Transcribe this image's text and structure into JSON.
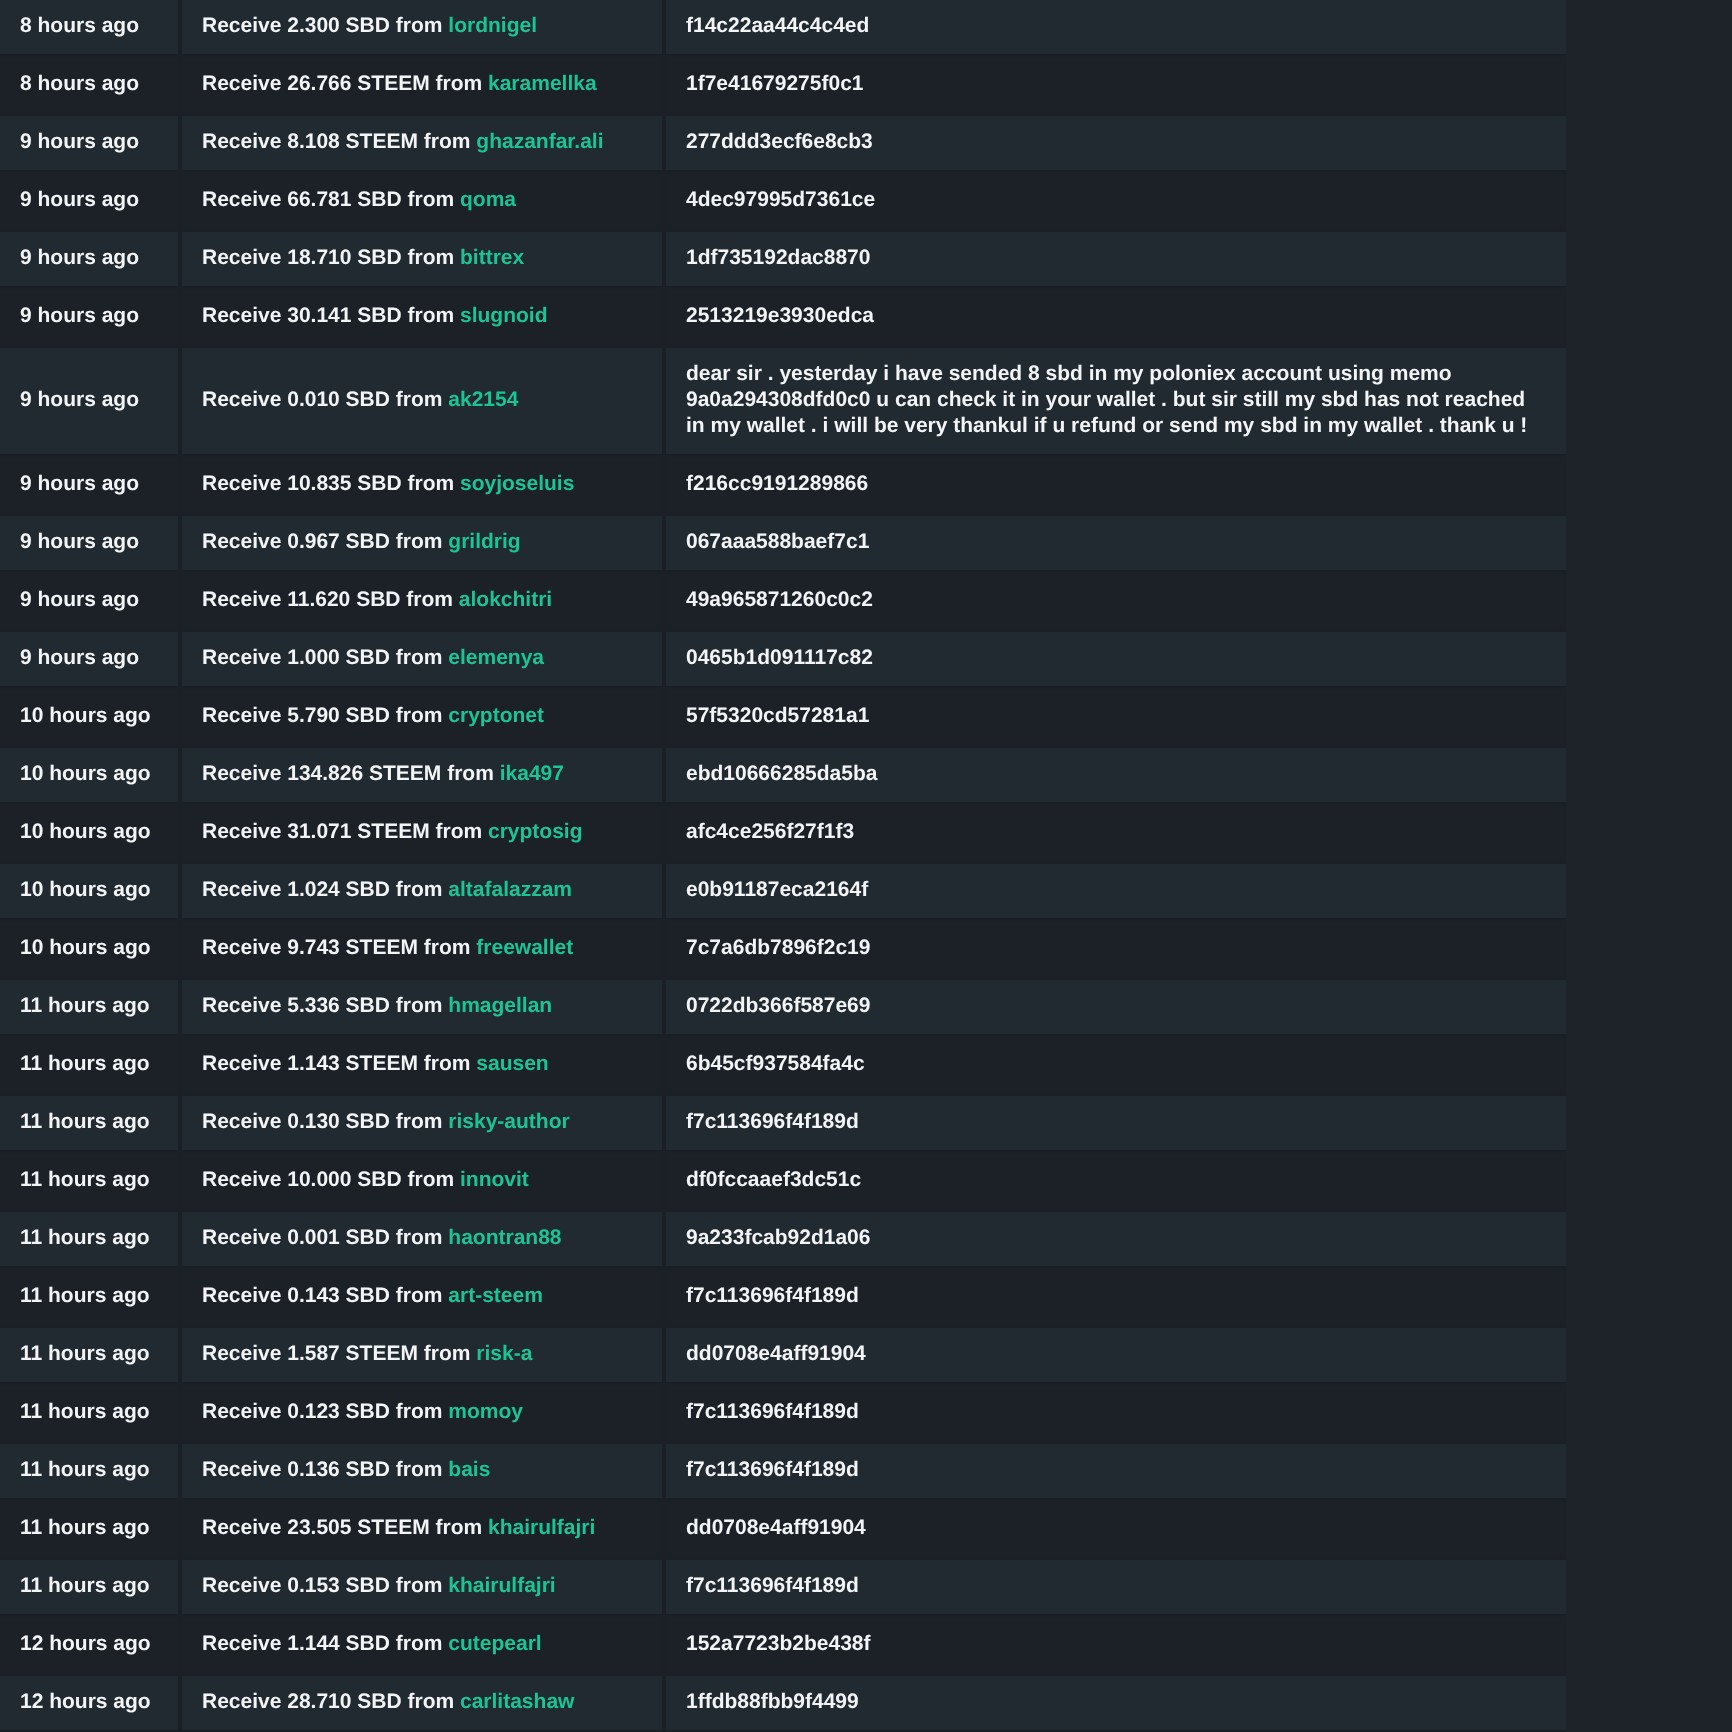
{
  "transfers": [
    {
      "time": "8 hours ago",
      "description": "Receive 2.300 SBD from",
      "from": "lordnigel",
      "memo": "f14c22aa44c4c4ed"
    },
    {
      "time": "8 hours ago",
      "description": "Receive 26.766 STEEM from",
      "from": "karamellka",
      "memo": "1f7e41679275f0c1"
    },
    {
      "time": "9 hours ago",
      "description": "Receive 8.108 STEEM from",
      "from": "ghazanfar.ali",
      "memo": "277ddd3ecf6e8cb3"
    },
    {
      "time": "9 hours ago",
      "description": "Receive 66.781 SBD from",
      "from": "qoma",
      "memo": "4dec97995d7361ce"
    },
    {
      "time": "9 hours ago",
      "description": "Receive 18.710 SBD from",
      "from": "bittrex",
      "memo": "1df735192dac8870"
    },
    {
      "time": "9 hours ago",
      "description": "Receive 30.141 SBD from",
      "from": "slugnoid",
      "memo": "2513219e3930edca"
    },
    {
      "time": "9 hours ago",
      "description": "Receive 0.010 SBD from",
      "from": "ak2154",
      "memo": "dear sir . yesterday i have sended 8 sbd in my poloniex account using memo 9a0a294308dfd0c0 u can check it in your wallet . but sir still my sbd has not reached in my wallet . i will be very thankul if u refund or send my sbd in my wallet . thank u !"
    },
    {
      "time": "9 hours ago",
      "description": "Receive 10.835 SBD from",
      "from": "soyjoseluis",
      "memo": "f216cc9191289866"
    },
    {
      "time": "9 hours ago",
      "description": "Receive 0.967 SBD from",
      "from": "grildrig",
      "memo": "067aaa588baef7c1"
    },
    {
      "time": "9 hours ago",
      "description": "Receive 11.620 SBD from",
      "from": "alokchitri",
      "memo": "49a965871260c0c2"
    },
    {
      "time": "9 hours ago",
      "description": "Receive 1.000 SBD from",
      "from": "elemenya",
      "memo": "0465b1d091117c82"
    },
    {
      "time": "10 hours ago",
      "description": "Receive 5.790 SBD from",
      "from": "cryptonet",
      "memo": "57f5320cd57281a1"
    },
    {
      "time": "10 hours ago",
      "description": "Receive 134.826 STEEM from",
      "from": "ika497",
      "memo": "ebd10666285da5ba"
    },
    {
      "time": "10 hours ago",
      "description": "Receive 31.071 STEEM from",
      "from": "cryptosig",
      "memo": "afc4ce256f27f1f3"
    },
    {
      "time": "10 hours ago",
      "description": "Receive 1.024 SBD from",
      "from": "altafalazzam",
      "memo": "e0b91187eca2164f"
    },
    {
      "time": "10 hours ago",
      "description": "Receive 9.743 STEEM from",
      "from": "freewallet",
      "memo": "7c7a6db7896f2c19"
    },
    {
      "time": "11 hours ago",
      "description": "Receive 5.336 SBD from",
      "from": "hmagellan",
      "memo": "0722db366f587e69"
    },
    {
      "time": "11 hours ago",
      "description": "Receive 1.143 STEEM from",
      "from": "sausen",
      "memo": "6b45cf937584fa4c"
    },
    {
      "time": "11 hours ago",
      "description": "Receive 0.130 SBD from",
      "from": "risky-author",
      "memo": "f7c113696f4f189d"
    },
    {
      "time": "11 hours ago",
      "description": "Receive 10.000 SBD from",
      "from": "innovit",
      "memo": "df0fccaaef3dc51c"
    },
    {
      "time": "11 hours ago",
      "description": "Receive 0.001 SBD from",
      "from": "haontran88",
      "memo": "9a233fcab92d1a06"
    },
    {
      "time": "11 hours ago",
      "description": "Receive 0.143 SBD from",
      "from": "art-steem",
      "memo": "f7c113696f4f189d"
    },
    {
      "time": "11 hours ago",
      "description": "Receive 1.587 STEEM from",
      "from": "risk-a",
      "memo": "dd0708e4aff91904"
    },
    {
      "time": "11 hours ago",
      "description": "Receive 0.123 SBD from",
      "from": "momoy",
      "memo": "f7c113696f4f189d"
    },
    {
      "time": "11 hours ago",
      "description": "Receive 0.136 SBD from",
      "from": "bais",
      "memo": "f7c113696f4f189d"
    },
    {
      "time": "11 hours ago",
      "description": "Receive 23.505 STEEM from",
      "from": "khairulfajri",
      "memo": "dd0708e4aff91904"
    },
    {
      "time": "11 hours ago",
      "description": "Receive 0.153 SBD from",
      "from": "khairulfajri",
      "memo": "f7c113696f4f189d"
    },
    {
      "time": "12 hours ago",
      "description": "Receive 1.144 SBD from",
      "from": "cutepearl",
      "memo": "152a7723b2be438f"
    },
    {
      "time": "12 hours ago",
      "description": "Receive 28.710 SBD from",
      "from": "carlitashaw",
      "memo": "1ffdb88fbb9f4499"
    }
  ]
}
